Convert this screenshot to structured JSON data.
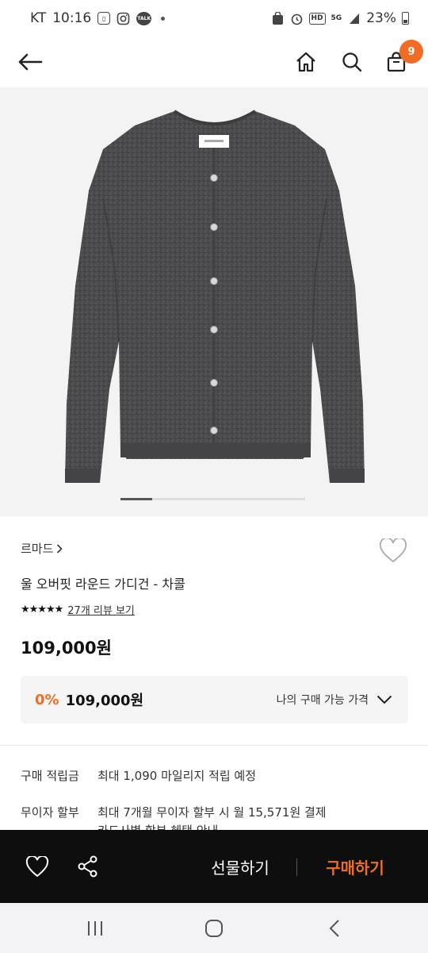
{
  "status_bar": {
    "carrier": "KT",
    "time": "10:16",
    "network": "5G",
    "hd": "HD",
    "talk": "TALK",
    "battery": "23%"
  },
  "header": {
    "back_icon": "back-arrow-icon",
    "home_icon": "home-icon",
    "search_icon": "search-icon",
    "cart_icon": "shopping-bag-icon",
    "cart_count": "9"
  },
  "product": {
    "image_label": "LEMARDE",
    "brand": "르마드",
    "name": "울 오버핏 라운드 가디건 - 차콜",
    "rating_stars": "★★★★★",
    "review_link": "27개 리뷰 보기",
    "price": "109,000원",
    "discount_rate": "0%",
    "final_price": "109,000원",
    "my_price_label": "나의 구매 가능 가격"
  },
  "benefits": [
    {
      "label": "구매 적립금",
      "value": "최대 1,090 마일리지 적립 예정"
    },
    {
      "label": "무이자 할부",
      "value": "최대 7개월 무이자 할부 시 월 15,571원 결제"
    },
    {
      "label": "",
      "value": "카드사별 할부 혜택 안내"
    }
  ],
  "action_bar": {
    "wish_icon": "heart-icon",
    "share_icon": "share-icon",
    "gift_label": "선물하기",
    "buy_label": "구매하기"
  },
  "system_nav": {
    "recents": "recents-icon",
    "home": "home-circle-icon",
    "back": "back-chevron-icon"
  },
  "colors": {
    "accent": "#f06d25",
    "action_bar": "#0e0e0e",
    "price_box": "#f5f5f5"
  }
}
